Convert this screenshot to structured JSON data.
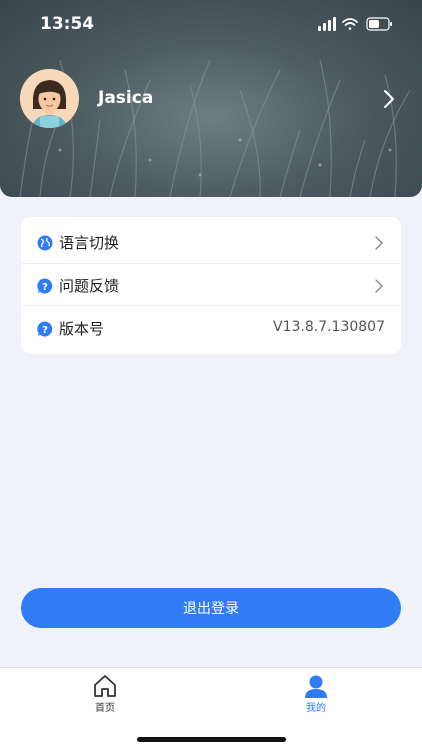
{
  "status_bar": {
    "time": "13:54",
    "battery_level": 0.55
  },
  "profile": {
    "name": "Jasica"
  },
  "menu": {
    "items": [
      {
        "label": "语言切换",
        "icon": "globe-icon"
      },
      {
        "label": "问题反馈",
        "icon": "question-icon"
      },
      {
        "label": "版本号",
        "icon": "question-icon",
        "value": "V13.8.7.130807"
      }
    ]
  },
  "logout_label": "退出登录",
  "tabbar": {
    "tabs": [
      {
        "label": "首页",
        "icon": "home-icon",
        "active": false
      },
      {
        "label": "我的",
        "icon": "person-icon",
        "active": true
      }
    ]
  },
  "colors": {
    "accent": "#2f7cf6",
    "inactive": "#333333"
  }
}
